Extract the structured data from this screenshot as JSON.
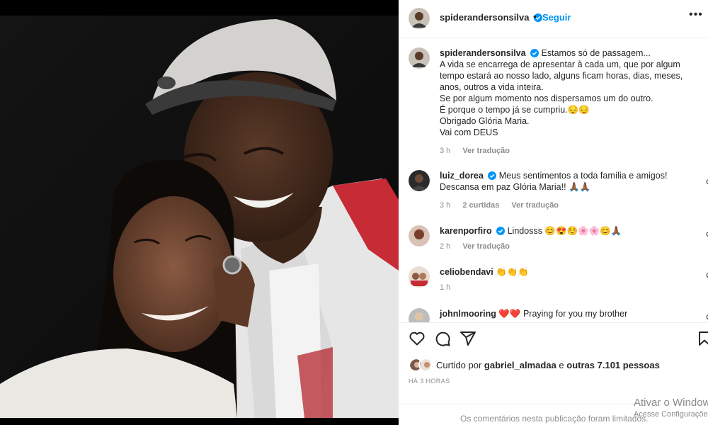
{
  "colors": {
    "accent": "#0095f6",
    "text": "#262626",
    "muted": "#8e8e8e",
    "heart": "#ed4956"
  },
  "post": {
    "username": "spiderandersonsilva",
    "dot": "•",
    "follow_label": "Seguir",
    "more_icon": "more-horizontal-icon"
  },
  "caption": {
    "username": "spiderandersonsilva",
    "lines": [
      "Estamos só de passagem...",
      "A vida se encarrega de apresentar à cada um, que por algum tempo estará ao nosso lado, alguns ficam horas, dias, meses, anos, outros a vida inteira.",
      "Se por algum momento nos dispersamos um do outro.",
      "É porque o tempo já se cumpriu.😔😔",
      "Obrigado Glória Maria.",
      "Vai com DEUS"
    ],
    "time": "3 h",
    "translate": "Ver tradução"
  },
  "comments": [
    {
      "username": "luiz_dorea",
      "verified": true,
      "text": "Meus sentimentos a toda família e amigos! Descansa em paz Glória Maria!! 🙏🏾🙏🏾",
      "time": "3 h",
      "likes": "2 curtidas",
      "translate": "Ver tradução"
    },
    {
      "username": "karenporfiro",
      "verified": true,
      "text": "Lindosss 😊😍☺️🌸🌸😊🙏🏾",
      "time": "2 h",
      "likes": "",
      "translate": "Ver tradução"
    },
    {
      "username": "celiobendavi",
      "verified": false,
      "text": "👏👏👏",
      "time": "1 h",
      "likes": "",
      "translate": ""
    },
    {
      "username": "johnlmooring",
      "verified": false,
      "text": "❤️❤️ Praying for you my brother",
      "time": "",
      "likes": "",
      "translate": ""
    }
  ],
  "actions": {
    "like_icon": "heart-icon",
    "comment_icon": "comment-icon",
    "share_icon": "share-icon",
    "save_icon": "bookmark-icon"
  },
  "likes": {
    "prefix": "Curtido por ",
    "user": "gabriel_almadaa",
    "middle": " e ",
    "others": "outras 7.101 pessoas"
  },
  "date": "HÁ 3 HORAS",
  "footer": {
    "limited": "Os comentários nesta publicação foram limitados."
  },
  "os_overlay": {
    "line1": "Ativar o Windows",
    "line2": "Acesse Configurações para ativar o Windows."
  }
}
